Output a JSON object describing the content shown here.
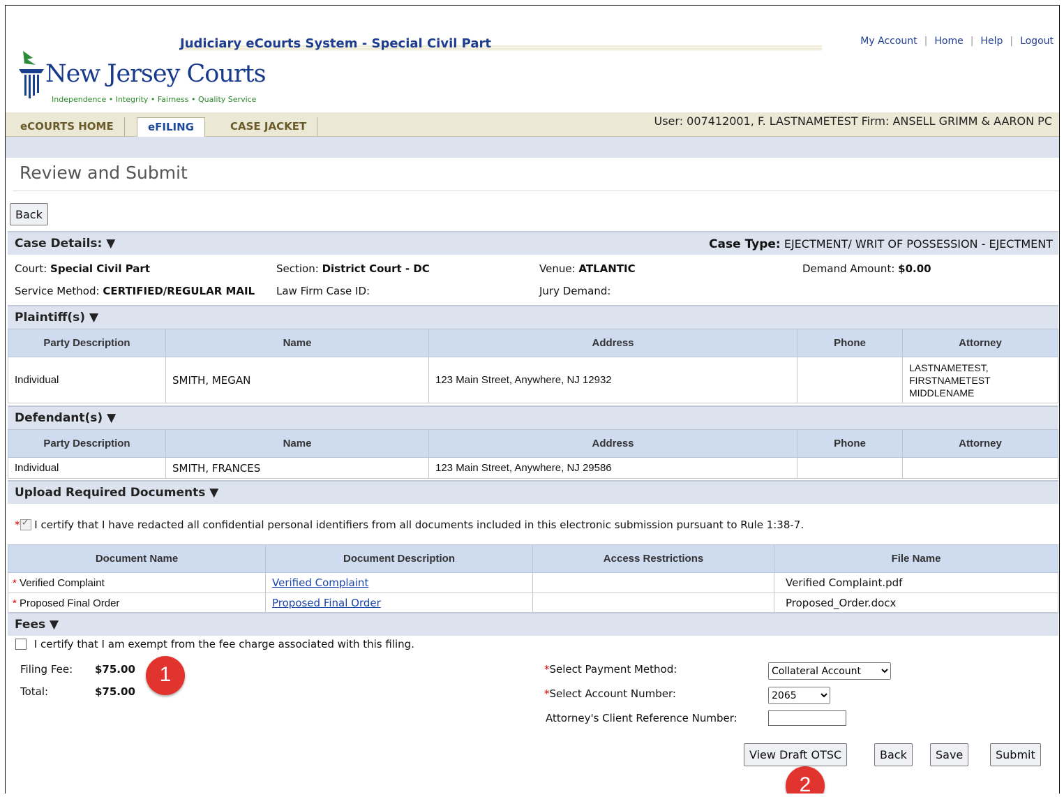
{
  "header": {
    "system_title": "Judiciary eCourts System - Special Civil Part",
    "links": [
      "My Account",
      "Home",
      "Help",
      "Logout"
    ],
    "logo_text": "New Jersey Courts",
    "logo_tagline": "Independence • Integrity • Fairness • Quality Service"
  },
  "nav": {
    "tabs": [
      "eCOURTS HOME",
      "eFILING",
      "CASE JACKET"
    ],
    "active_tab": "eFILING",
    "user_line": "User: 007412001, F. LASTNAMETEST  Firm: ANSELL GRIMM & AARON PC"
  },
  "page": {
    "title": "Review and Submit",
    "back_label": "Back"
  },
  "case_details": {
    "section_label": "Case Details: ▼",
    "case_type_label": "Case Type:",
    "case_type_value": "EJECTMENT/ WRIT OF POSSESSION - EJECTMENT",
    "court_label": "Court:",
    "court_value": "Special Civil Part",
    "section_label2": "Section:",
    "section_value": "District Court - DC",
    "venue_label": "Venue:",
    "venue_value": "ATLANTIC",
    "demand_label": "Demand Amount:",
    "demand_value": "$0.00",
    "service_label": "Service Method:",
    "service_value": "CERTIFIED/REGULAR MAIL",
    "lawfirm_label": "Law Firm Case ID:",
    "jury_label": "Jury Demand:"
  },
  "plaintiffs": {
    "section_label": "Plaintiff(s) ▼",
    "columns": [
      "Party Description",
      "Name",
      "Address",
      "Phone",
      "Attorney"
    ],
    "row": [
      "Individual",
      "SMITH, MEGAN",
      "123 Main Street, Anywhere, NJ 12932",
      "",
      "LASTNAMETEST, FIRSTNAMETEST MIDDLENAME"
    ]
  },
  "defendants": {
    "section_label": "Defendant(s) ▼",
    "columns": [
      "Party Description",
      "Name",
      "Address",
      "Phone",
      "Attorney"
    ],
    "row": [
      "Individual",
      "SMITH, FRANCES",
      "123 Main Street, Anywhere, NJ 29586",
      "",
      ""
    ]
  },
  "documents": {
    "section_label": "Upload Required Documents ▼",
    "certify_text": "I certify that I have redacted all confidential personal identifiers from all documents included in this electronic submission pursuant to Rule 1:38-7.",
    "certified": true,
    "columns": [
      "Document Name",
      "Document Description",
      "Access Restrictions",
      "File Name"
    ],
    "rows": [
      {
        "name": "Verified Complaint",
        "description": "Verified Complaint",
        "access": "",
        "file": "Verified Complaint.pdf"
      },
      {
        "name": "Proposed Final Order",
        "description": "Proposed Final Order",
        "access": "",
        "file": "Proposed_Order.docx"
      }
    ]
  },
  "fees": {
    "section_label": "Fees ▼",
    "exempt_text": "I certify that I am exempt from the fee charge associated with this filing.",
    "exempt_checked": false,
    "filing_fee_label": "Filing Fee:",
    "filing_fee_value": "$75.00",
    "total_label": "Total:",
    "total_value": "$75.00",
    "payment_method_label": "Select Payment Method:",
    "payment_method_value": "Collateral Account",
    "account_number_label": "Select Account Number:",
    "account_number_value": "2065",
    "client_ref_label": "Attorney's Client Reference Number:",
    "client_ref_value": ""
  },
  "actions": {
    "view_draft": "View Draft OTSC",
    "back": "Back",
    "save": "Save",
    "submit": "Submit"
  },
  "callouts": [
    "1",
    "2"
  ],
  "colors": {
    "callout": "#e2342f",
    "section_band": "#dde3ee",
    "table_header": "#cfdcf0",
    "link": "#1a44a8"
  }
}
